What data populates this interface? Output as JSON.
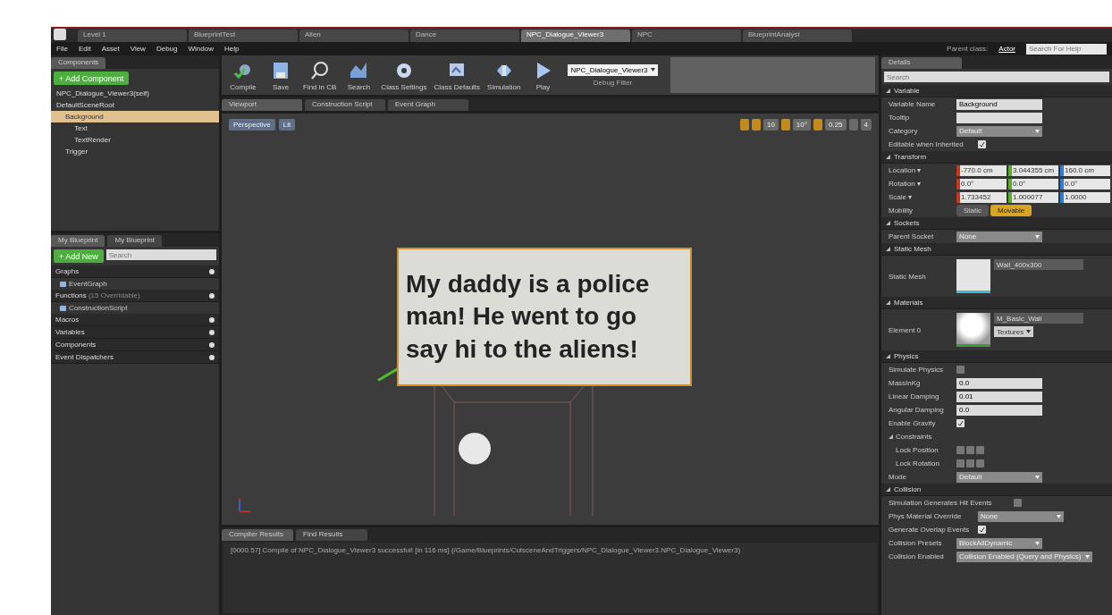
{
  "document_tabs": [
    {
      "label": "Level 1",
      "selected": false
    },
    {
      "label": "BlueprintTest",
      "selected": false
    },
    {
      "label": "Alien",
      "selected": false
    },
    {
      "label": "Dance",
      "selected": false
    },
    {
      "label": "NPC_Dialogue_Viewer3",
      "selected": true
    },
    {
      "label": "NPC",
      "selected": false
    },
    {
      "label": "BlueprintAnalyst",
      "selected": false
    }
  ],
  "menu": [
    "File",
    "Edit",
    "Asset",
    "View",
    "Debug",
    "Window",
    "Help"
  ],
  "parent_class": {
    "label": "Parent class:",
    "value": "Actor"
  },
  "help_search": {
    "placeholder": "Search For Help"
  },
  "components": {
    "tab": "Components",
    "add_button": "+ Add Component",
    "self_item": "NPC_Dialogue_Viewer3(self)",
    "tree": [
      {
        "label": "DefaultSceneRoot",
        "selected": false,
        "children": [
          {
            "label": "Background",
            "selected": true,
            "children": [
              {
                "label": "Text",
                "selected": false
              },
              {
                "label": "TextRender",
                "selected": false
              }
            ]
          },
          {
            "label": "Trigger",
            "selected": false
          }
        ]
      }
    ]
  },
  "my_blueprint": {
    "tabs": [
      {
        "label": "My Blueprint",
        "selected": true
      },
      {
        "label": "My Blueprint",
        "selected": false
      }
    ],
    "add_button": "+ Add New",
    "search": {
      "placeholder": "Search"
    },
    "sections": [
      {
        "label": "Graphs",
        "items": [
          "EventGraph"
        ]
      },
      {
        "label": "Functions",
        "note": "(15 Overridable)",
        "items": [
          "ConstructionScript"
        ]
      },
      {
        "label": "Macros"
      },
      {
        "label": "Variables"
      },
      {
        "label": "Components"
      },
      {
        "label": "Event Dispatchers"
      }
    ]
  },
  "toolbar": [
    {
      "label": "Compile"
    },
    {
      "label": "Save"
    },
    {
      "label": "Find in CB"
    },
    {
      "label": "Search"
    },
    {
      "label": "Class Settings"
    },
    {
      "label": "Class Defaults"
    },
    {
      "label": "Simulation"
    },
    {
      "label": "Play"
    }
  ],
  "debug_filter": {
    "value": "NPC_Dialogue_Viewer3",
    "label": "Debug Filter"
  },
  "editor_tabs": [
    {
      "label": "Viewport",
      "selected": true
    },
    {
      "label": "Construction Script",
      "selected": false
    },
    {
      "label": "Event Graph",
      "selected": false
    }
  ],
  "viewport": {
    "buttons": [
      "Perspective",
      "Lit"
    ],
    "snap_values": [
      "10",
      "10°",
      "0.25",
      "4"
    ],
    "sign_lines": [
      "My daddy is a police",
      "man! He went to go",
      "say hi to the aliens!"
    ]
  },
  "output": {
    "tabs": [
      {
        "label": "Compiler Results",
        "selected": true
      },
      {
        "label": "Find Results",
        "selected": false
      }
    ],
    "log": "[0000.57] Compile of NPC_Dialogue_Viewer3 successful! [in 116 ms] (/Game/Blueprints/CutsceneAndTriggers/NPC_Dialogue_Viewer3.NPC_Dialogue_Viewer3)"
  },
  "details": {
    "tab": "Details",
    "search": {
      "placeholder": "Search"
    },
    "sections": [
      {
        "title": "Variable",
        "rows": [
          {
            "kind": "text",
            "label": "Variable Name",
            "value": "Background"
          },
          {
            "kind": "text",
            "label": "Tooltip"
          },
          {
            "kind": "dropdown",
            "label": "Category",
            "value": "Default"
          },
          {
            "kind": "check",
            "label": "Editable when Inherited",
            "checked": true
          }
        ]
      },
      {
        "title": "Transform",
        "rows": [
          {
            "kind": "vector",
            "label": "Location ▾",
            "values": [
              "-770.0 cm",
              "3.044355 cm",
              "160.0 cm"
            ]
          },
          {
            "kind": "vector",
            "label": "Rotation ▾",
            "values": [
              "0.0°",
              "0.0°",
              "0.0°"
            ]
          },
          {
            "kind": "vector",
            "label": "Scale ▾",
            "values": [
              "1.733452",
              "1.000077",
              "1.0000"
            ]
          },
          {
            "kind": "mobility",
            "label": "Mobility",
            "options": [
              {
                "label": "Static",
                "selected": false
              },
              {
                "label": "Movable",
                "selected": true
              }
            ]
          }
        ]
      },
      {
        "title": "Sockets",
        "rows": [
          {
            "kind": "dropdown",
            "label": "Parent Socket",
            "value": "None"
          }
        ]
      },
      {
        "title": "Static Mesh",
        "rows": [
          {
            "kind": "asset",
            "label": "Static Mesh",
            "value": "Wall_400x300"
          }
        ]
      },
      {
        "title": "Materials",
        "rows": [
          {
            "kind": "asset",
            "label": "Element 0",
            "value": "M_Basic_Wall",
            "button": "Textures"
          }
        ]
      },
      {
        "title": "Physics",
        "rows": [
          {
            "kind": "check",
            "label": "Simulate Physics",
            "checked": false
          },
          {
            "kind": "text",
            "label": "MassInKg",
            "value": "0.0"
          },
          {
            "kind": "text",
            "label": "Linear Damping",
            "value": "0.01"
          },
          {
            "kind": "text",
            "label": "Angular Damping",
            "value": "0.0"
          },
          {
            "kind": "check",
            "label": "Enable Gravity",
            "checked": true
          },
          {
            "kind": "group",
            "label": "Constraints"
          },
          {
            "kind": "locks",
            "label": "Lock Position",
            "checks": [
              false,
              false,
              false
            ]
          },
          {
            "kind": "locks",
            "label": "Lock Rotation",
            "checks": [
              false,
              false,
              false
            ]
          },
          {
            "kind": "dropdown",
            "label": "Mode",
            "value": "Default"
          }
        ]
      },
      {
        "title": "Collision",
        "rows": [
          {
            "kind": "check",
            "label": "Simulation Generates Hit Events",
            "checked": false
          },
          {
            "kind": "dropdown",
            "label": "Phys Material Override",
            "value": "None"
          },
          {
            "kind": "check",
            "label": "Generate Overlap Events",
            "checked": true
          },
          {
            "kind": "dropdown",
            "label": "Collision Presets",
            "value": "BlockAllDynamic"
          },
          {
            "kind": "dropdown",
            "label": "Collision Enabled",
            "value": "Collision Enabled (Query and Physics)"
          }
        ]
      }
    ]
  }
}
